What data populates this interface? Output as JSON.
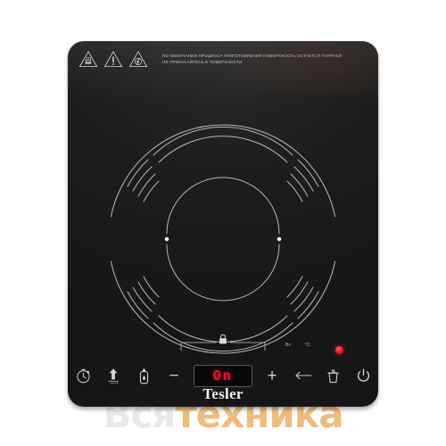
{
  "product": {
    "brand": "Tesler",
    "type": "induction-cooktop"
  },
  "warnings": {
    "line1": "ПО ОКОНЧАНИИ ПРОЦЕССА ПРИГОТОВЛЕНИЯ ПОВЕРХНОСТЬ ОСТАЕТСЯ ГОРЯЧЕЙ",
    "line2": "НЕ ПРИКАСАЙТЕСЬ К ПОВЕРХНОСТИ",
    "icons": [
      "hot-surface-warning-icon",
      "general-warning-icon",
      "magnetic-field-warning-icon"
    ]
  },
  "control_panel": {
    "timer_label": "timer-icon",
    "boost_label": "power-boost-icon",
    "keep_warm_label": "keep-warm-icon",
    "minus_label": "−",
    "plus_label": "+",
    "display_value": "On",
    "lock_label": "lock-icon",
    "units": [
      "Вт",
      "°C"
    ],
    "menu_label": "function-select-icon",
    "pot_label": "pot-icon",
    "power_label": "power-icon",
    "indicator_state": "on"
  },
  "watermark": {
    "part1": "Вся",
    "part2": "техника"
  },
  "colors": {
    "body": "#1d1d1d",
    "led_red": "#e8113a",
    "indicator_red": "#ec1b26",
    "ring_line": "#bdbdbd",
    "watermark_orange": "#f0bb7c"
  }
}
